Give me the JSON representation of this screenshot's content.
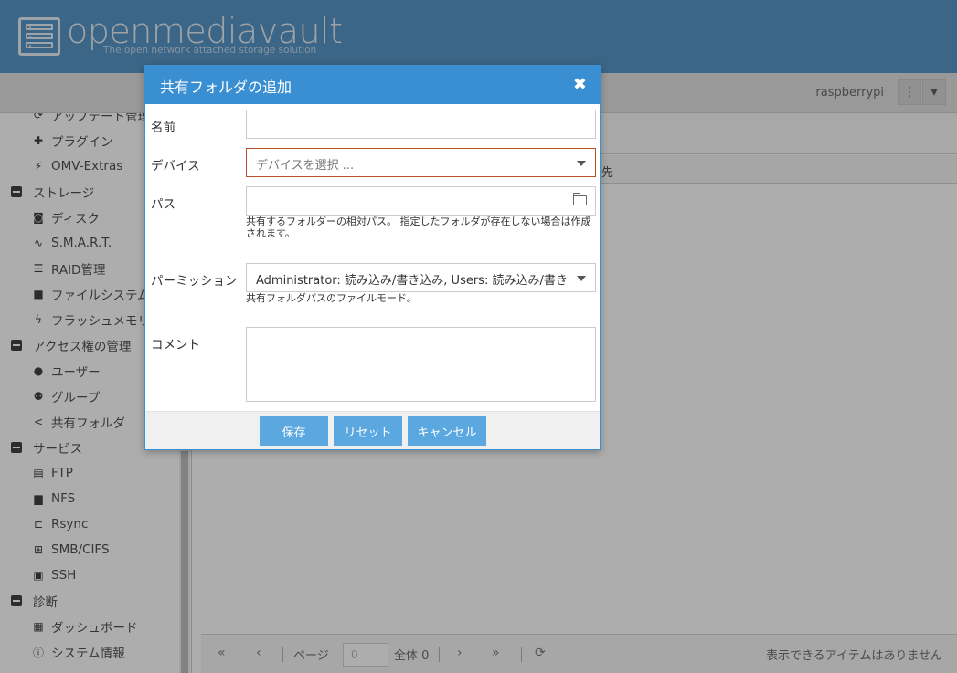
{
  "header": {
    "title": "openmediavault",
    "subtitle": "The open network attached storage solution"
  },
  "toolbar": {
    "hostname": "raspberrypi",
    "menu_icon": "ellipsis-vertical-icon",
    "dropdown_icon": "caret-down-icon"
  },
  "sidebar": {
    "items": [
      {
        "label": "アップデート管理",
        "icon": "refresh-icon",
        "kind": "child"
      },
      {
        "label": "プラグイン",
        "icon": "puzzle-icon",
        "kind": "child"
      },
      {
        "label": "OMV-Extras",
        "icon": "plug-icon",
        "kind": "child"
      },
      {
        "label": "ストレージ",
        "icon": "minus-square-icon",
        "kind": "group"
      },
      {
        "label": "ディスク",
        "icon": "hdd-icon",
        "kind": "child"
      },
      {
        "label": "S.M.A.R.T.",
        "icon": "pulse-icon",
        "kind": "child"
      },
      {
        "label": "RAID管理",
        "icon": "database-icon",
        "kind": "child"
      },
      {
        "label": "ファイルシステム",
        "icon": "folder-icon",
        "kind": "child"
      },
      {
        "label": "フラッシュメモリ",
        "icon": "bolt-icon",
        "kind": "child"
      },
      {
        "label": "アクセス権の管理",
        "icon": "minus-square-icon",
        "kind": "group"
      },
      {
        "label": "ユーザー",
        "icon": "user-icon",
        "kind": "child"
      },
      {
        "label": "グループ",
        "icon": "users-icon",
        "kind": "child"
      },
      {
        "label": "共有フォルダ",
        "icon": "share-icon",
        "kind": "child"
      },
      {
        "label": "サービス",
        "icon": "minus-square-icon",
        "kind": "group"
      },
      {
        "label": "FTP",
        "icon": "server-icon",
        "kind": "child"
      },
      {
        "label": "NFS",
        "icon": "desktop-icon",
        "kind": "child"
      },
      {
        "label": "Rsync",
        "icon": "sitemap-icon",
        "kind": "child"
      },
      {
        "label": "SMB/CIFS",
        "icon": "windows-icon",
        "kind": "child"
      },
      {
        "label": "SSH",
        "icon": "terminal-icon",
        "kind": "child"
      },
      {
        "label": "診断",
        "icon": "minus-square-icon",
        "kind": "group"
      },
      {
        "label": "ダッシュボード",
        "icon": "dashboard-icon",
        "kind": "child"
      },
      {
        "label": "システム情報",
        "icon": "info-icon",
        "kind": "child"
      }
    ]
  },
  "main": {
    "column_tail": "先",
    "pager": {
      "page_label": "ページ",
      "page_value": "0",
      "total": "全体 0",
      "empty_message": "表示できるアイテムはありません"
    }
  },
  "dialog": {
    "title": "共有フォルダの追加",
    "close_icon": "close-icon",
    "fields": {
      "name": {
        "label": "名前",
        "value": ""
      },
      "device": {
        "label": "デバイス",
        "placeholder": "デバイスを選択 ..."
      },
      "path": {
        "label": "パス",
        "value": "",
        "hint": "共有するフォルダーの相対パス。 指定したフォルダが存在しない場合は作成されます。"
      },
      "permission": {
        "label": "パーミッション",
        "value": "Administrator: 読み込み/書き込み, Users: 読み込み/書き",
        "hint": "共有フォルダパスのファイルモード。"
      },
      "comment": {
        "label": "コメント",
        "value": ""
      }
    },
    "buttons": {
      "save": "保存",
      "reset": "リセット",
      "cancel": "キャンセル"
    }
  },
  "colors": {
    "header": "#3d86bd",
    "dialog_header": "#3a8fd3",
    "button": "#5ba7df",
    "error_border": "#b5522d"
  }
}
